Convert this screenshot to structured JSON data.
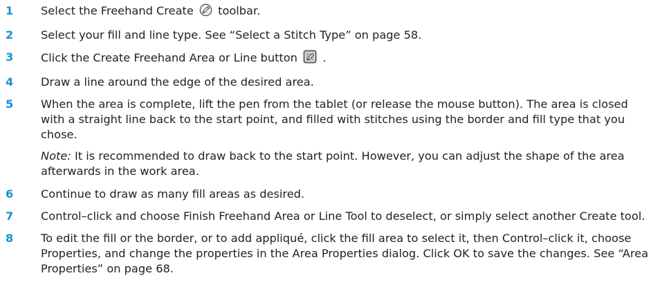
{
  "steps": [
    {
      "number": "1",
      "text_before_icon": "Select the Freehand Create",
      "icon": "freehand-create-toolbar-icon",
      "text_after_icon": "toolbar."
    },
    {
      "number": "2",
      "text": "Select your fill and line type. See “Select a Stitch Type” on page 58."
    },
    {
      "number": "3",
      "text_before_icon": "Click the Create Freehand Area or Line button",
      "icon": "create-freehand-area-button-icon",
      "text_after_icon": "."
    },
    {
      "number": "4",
      "text": "Draw a line around the edge of the desired area."
    },
    {
      "number": "5",
      "text": "When the area is complete, lift the pen from the tablet (or release the mouse button). The area is closed with a straight line back to the start point, and filled with stitches using the border and fill type that you chose.",
      "note_label": "Note:",
      "note_text": "It is recommended to draw back to the start point. However, you can adjust the shape of the area afterwards in the work area."
    },
    {
      "number": "6",
      "text": "Continue to draw as many fill areas as desired."
    },
    {
      "number": "7",
      "text": "Control–click and choose Finish Freehand Area or Line Tool to deselect, or simply select another Create tool."
    },
    {
      "number": "8",
      "text": "To edit the fill or the border, or to add appliqué, click the fill area to select it, then Control–click it, choose Properties, and change the properties in the Area Properties dialog. Click OK to save the changes. See “Area Properties” on page 68."
    }
  ],
  "colors": {
    "step_number": "#1a8fd6",
    "text": "#222222",
    "background": "#ffffff"
  }
}
